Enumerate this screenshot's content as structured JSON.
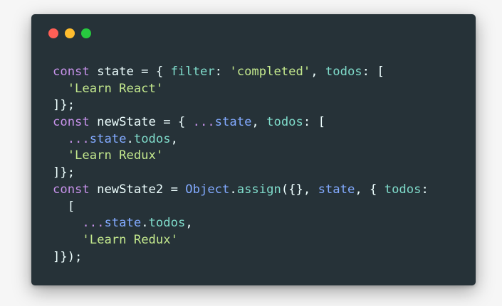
{
  "window": {
    "traffic_lights": [
      {
        "name": "close",
        "color": "#ff5f56"
      },
      {
        "name": "minimize",
        "color": "#ffbd2e"
      },
      {
        "name": "maximize",
        "color": "#27c93f"
      }
    ]
  },
  "code": {
    "language": "javascript",
    "lines": [
      [
        {
          "t": "const",
          "k": "kw"
        },
        {
          "t": " state = { ",
          "k": "id"
        },
        {
          "t": "filter",
          "k": "prop"
        },
        {
          "t": ": ",
          "k": "pun"
        },
        {
          "t": "'completed'",
          "k": "str"
        },
        {
          "t": ", ",
          "k": "pun"
        },
        {
          "t": "todos",
          "k": "prop"
        },
        {
          "t": ": [",
          "k": "pun"
        }
      ],
      [
        {
          "t": "  ",
          "k": "pun"
        },
        {
          "t": "'Learn React'",
          "k": "str"
        }
      ],
      [
        {
          "t": "]};",
          "k": "pun"
        }
      ],
      [
        {
          "t": "const",
          "k": "kw"
        },
        {
          "t": " newState = { ",
          "k": "id"
        },
        {
          "t": "...",
          "k": "kw"
        },
        {
          "t": "state",
          "k": "fn"
        },
        {
          "t": ", ",
          "k": "pun"
        },
        {
          "t": "todos",
          "k": "prop"
        },
        {
          "t": ": [",
          "k": "pun"
        }
      ],
      [
        {
          "t": "  ",
          "k": "pun"
        },
        {
          "t": "...",
          "k": "kw"
        },
        {
          "t": "state",
          "k": "fn"
        },
        {
          "t": ".",
          "k": "pun"
        },
        {
          "t": "todos",
          "k": "prop"
        },
        {
          "t": ",",
          "k": "pun"
        }
      ],
      [
        {
          "t": "  ",
          "k": "pun"
        },
        {
          "t": "'Learn Redux'",
          "k": "str"
        }
      ],
      [
        {
          "t": "]};",
          "k": "pun"
        }
      ],
      [
        {
          "t": "const",
          "k": "kw"
        },
        {
          "t": " newState2 = ",
          "k": "id"
        },
        {
          "t": "Object",
          "k": "fn"
        },
        {
          "t": ".",
          "k": "pun"
        },
        {
          "t": "assign",
          "k": "prop"
        },
        {
          "t": "({}, ",
          "k": "pun"
        },
        {
          "t": "state",
          "k": "fn"
        },
        {
          "t": ", { ",
          "k": "pun"
        },
        {
          "t": "todos",
          "k": "prop"
        },
        {
          "t": ":",
          "k": "pun"
        }
      ],
      [
        {
          "t": "  [",
          "k": "pun"
        }
      ],
      [
        {
          "t": "    ",
          "k": "pun"
        },
        {
          "t": "...",
          "k": "kw"
        },
        {
          "t": "state",
          "k": "fn"
        },
        {
          "t": ".",
          "k": "pun"
        },
        {
          "t": "todos",
          "k": "prop"
        },
        {
          "t": ",",
          "k": "pun"
        }
      ],
      [
        {
          "t": "    ",
          "k": "pun"
        },
        {
          "t": "'Learn Redux'",
          "k": "str"
        }
      ],
      [
        {
          "t": "]});",
          "k": "pun"
        }
      ]
    ]
  }
}
